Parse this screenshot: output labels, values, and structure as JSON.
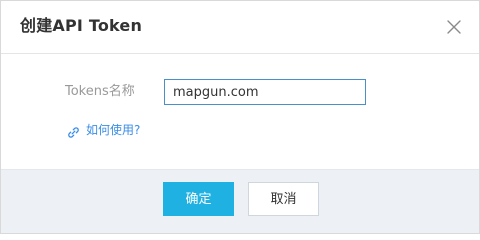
{
  "dialog": {
    "title": "创建API Token",
    "close_icon": "close-icon"
  },
  "form": {
    "token_name_label": "Tokens名称",
    "token_name_value": "mapgun.com",
    "help_icon": "link-icon",
    "help_link_text": "如何使用?"
  },
  "footer": {
    "confirm_label": "确定",
    "cancel_label": "取消"
  },
  "colors": {
    "primary": "#20b1e3",
    "link": "#3a8ee6",
    "input_focus_border": "#4a90c8",
    "footer_bg": "#edf1f5"
  }
}
